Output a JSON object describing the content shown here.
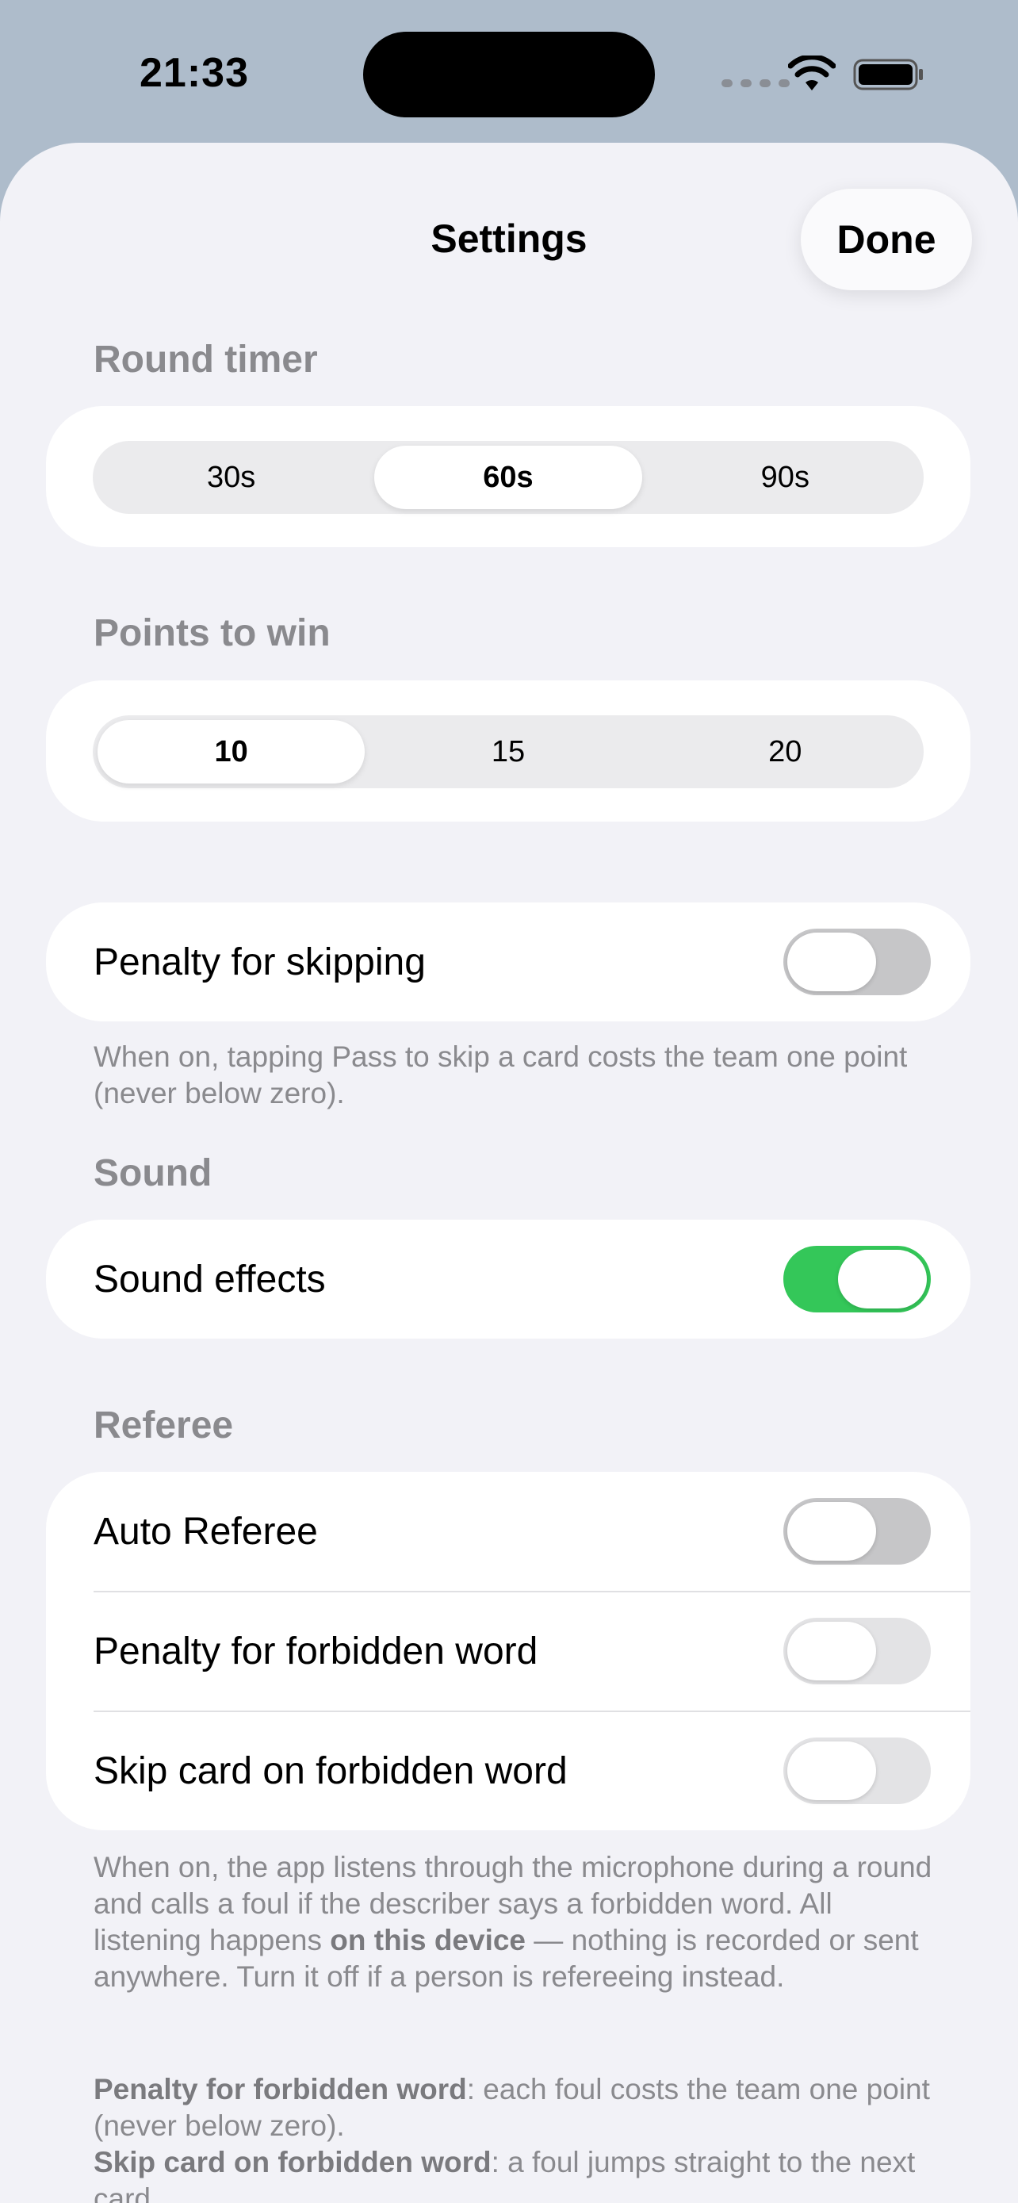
{
  "status": {
    "time": "21:33"
  },
  "nav": {
    "title": "Settings",
    "done": "Done"
  },
  "round_timer": {
    "header": "Round timer",
    "options": [
      "30s",
      "60s",
      "90s"
    ],
    "selected": "60s"
  },
  "points_to_win": {
    "header": "Points to win",
    "options": [
      "10",
      "15",
      "20"
    ],
    "selected": "10"
  },
  "penalty_skip": {
    "label": "Penalty for skipping",
    "on": false,
    "footnote": "When on, tapping Pass to skip a card costs the team one point (never below zero)."
  },
  "sound": {
    "header": "Sound",
    "label": "Sound effects",
    "on": true
  },
  "referee": {
    "header": "Referee",
    "rows": [
      {
        "label": "Auto Referee",
        "on": false
      },
      {
        "label": "Penalty for forbidden word",
        "on": false
      },
      {
        "label": "Skip card on forbidden word",
        "on": false
      }
    ],
    "footnote_a": "When on, the app listens through the microphone during a round and calls a foul if the describer says a forbidden word. All listening happens ",
    "footnote_bold": "on this device",
    "footnote_b": " — nothing is recorded or sent anywhere. Turn it off if a person is refereeing instead.",
    "penalty_title": "Penalty for forbidden word",
    "penalty_text": ": each foul costs the team one point (never below zero).",
    "skip_title": "Skip card on forbidden word",
    "skip_text": ": a foul jumps straight to the next card."
  },
  "colors": {
    "accent_green": "#34c759",
    "background": "#f2f2f7"
  },
  "icons": [
    "wifi-icon",
    "battery-icon",
    "cellular-signal-icon"
  ]
}
